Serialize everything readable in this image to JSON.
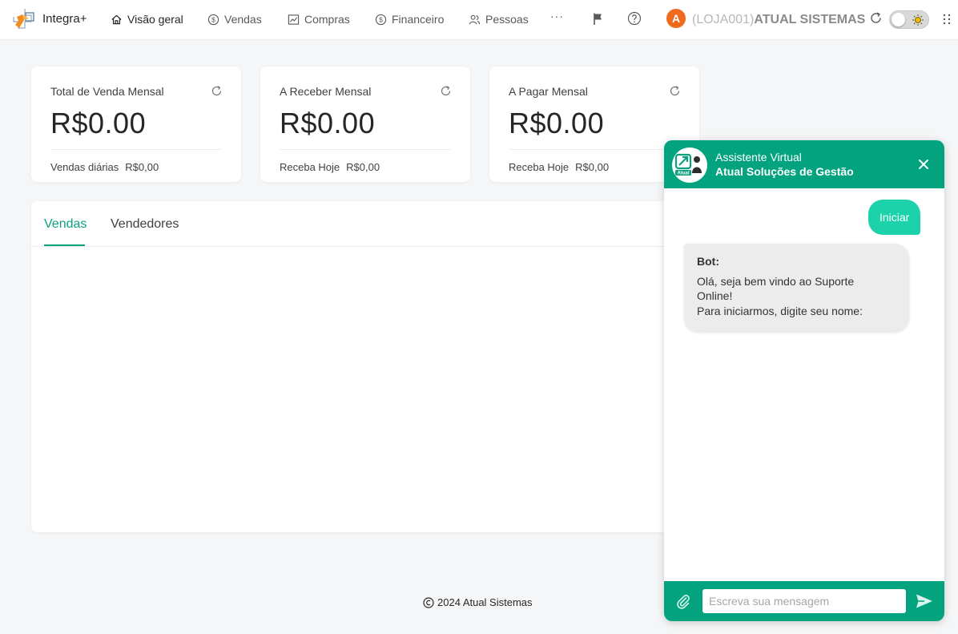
{
  "topbar": {
    "brand": "Integra+",
    "nav": [
      {
        "label": "Visão geral",
        "icon": "home-icon"
      },
      {
        "label": "Vendas",
        "icon": "dollar-circle-icon"
      },
      {
        "label": "Compras",
        "icon": "line-chart-icon"
      },
      {
        "label": "Financeiro",
        "icon": "dollar-circle-icon"
      },
      {
        "label": "Pessoas",
        "icon": "people-icon"
      }
    ],
    "more": "···",
    "avatar_letter": "A",
    "user_prefix": "(LOJA001)",
    "user_company": "ATUAL SISTEMAS"
  },
  "cards": [
    {
      "title": "Total de Venda Mensal",
      "value": "R$0.00",
      "footer_label": "Vendas diárias",
      "footer_value": "R$0,00"
    },
    {
      "title": "A Receber Mensal",
      "value": "R$0.00",
      "footer_label": "Receba Hoje",
      "footer_value": "R$0,00"
    },
    {
      "title": "A Pagar Mensal",
      "value": "R$0.00",
      "footer_label": "Receba Hoje",
      "footer_value": "R$0,00"
    }
  ],
  "tabs": [
    {
      "label": "Vendas",
      "active": true
    },
    {
      "label": "Vendedores",
      "active": false
    }
  ],
  "footer": {
    "text": "2024 Atual Sistemas"
  },
  "chat": {
    "title": "Assistente Virtual",
    "subtitle": "Atual Soluções de Gestão",
    "logo_text": "Atual",
    "user_message": "Iniciar",
    "bot_name": "Bot:",
    "bot_line1": "Olá, seja bem vindo ao Suporte",
    "bot_line2": "Online!",
    "bot_line3": "Para iniciarmos, digite seu nome:",
    "input_placeholder": "Escreva sua mensagem",
    "input_value": ""
  },
  "colors": {
    "accent": "#0e9f7e",
    "chat_header": "#03a37f",
    "user_bubble": "#1bd2aa",
    "avatar": "#f06a1d"
  }
}
